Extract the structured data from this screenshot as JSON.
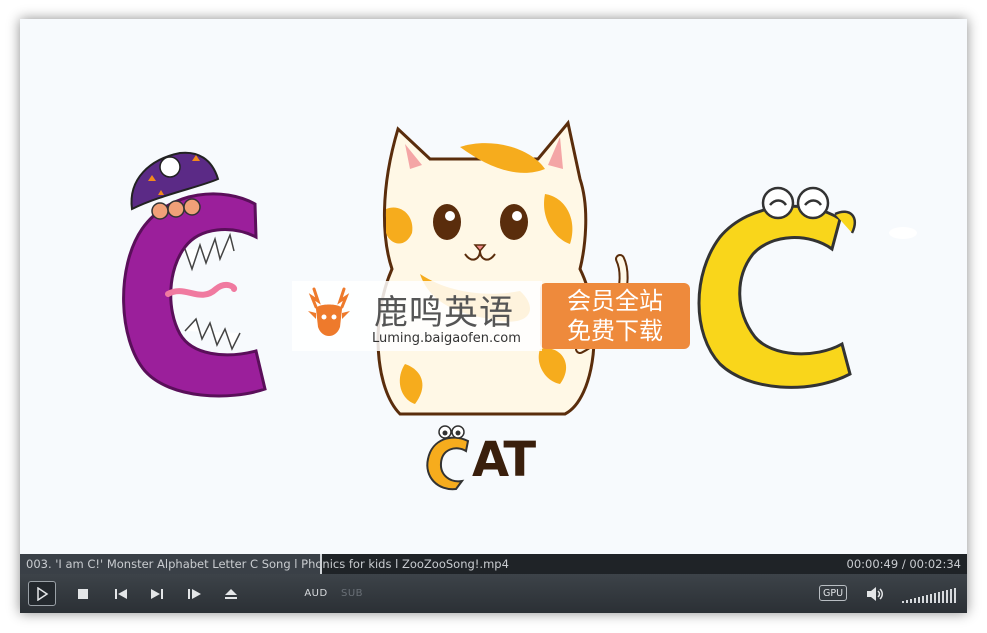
{
  "player": {
    "file_title": "003. 'I am C!' Monster Alphabet Letter C Song l Phonics for kids l ZooZooSong!.mp4",
    "time_display": "00:00:49 / 00:02:34",
    "progress_fraction": 0.318,
    "buttons": {
      "play": "play-icon",
      "stop": "stop-icon",
      "previous": "skip-previous-icon",
      "next": "skip-next-icon",
      "frame_step": "frame-step-icon",
      "eject": "eject-icon",
      "audio_label": "AUD",
      "subtitle_label": "SUB",
      "gpu_label": "GPU",
      "volume": "speaker-icon"
    },
    "volume_level": 1.0
  },
  "video": {
    "word": "AT",
    "watermark": {
      "brand": "鹿鸣英语",
      "url": "Luming.baigaofen.com",
      "promo_line1": "会员全站",
      "promo_line2": "免费下载"
    }
  },
  "colors": {
    "purple_letter": "#9b1f9b",
    "yellow_letter": "#f9d61b",
    "cat_orange": "#f6ac1d",
    "watermark_orange": "#ee8a3c",
    "bar_bg": "#1f2327"
  }
}
